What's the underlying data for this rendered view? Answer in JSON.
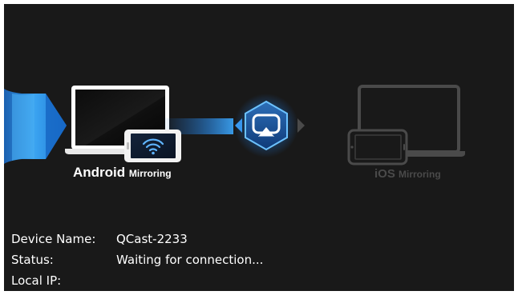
{
  "modes": {
    "android": {
      "name": "Android",
      "suffix": "Mirroring",
      "state": "active"
    },
    "ios": {
      "name": "iOS",
      "suffix": "Mirroring",
      "state": "inactive"
    }
  },
  "center_icon": "screen-mirroring-icon",
  "device_info": {
    "device_name": {
      "label": "Device Name:",
      "value": "QCast-2233"
    },
    "status": {
      "label": "Status:",
      "value": "Waiting for connection..."
    },
    "local_ip": {
      "label": "Local IP:",
      "value": ""
    }
  },
  "colors": {
    "background": "#191919",
    "accent": "#2a8fe6",
    "active_text": "#ffffff",
    "inactive": "#4a4a4a"
  }
}
